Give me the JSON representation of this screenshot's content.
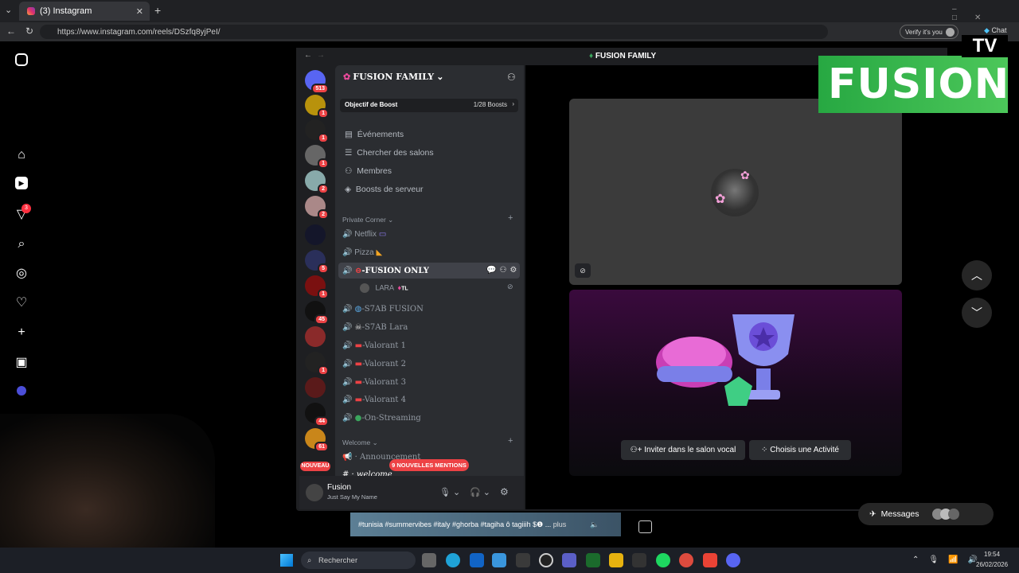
{
  "browser": {
    "tab_title": "(3) Instagram",
    "url": "https://www.instagram.com/reels/DSzfq8yjPeI/",
    "verify_label": "Verify it's you",
    "chat_label": "Chat"
  },
  "instagram": {
    "notif_count": "3",
    "caption": "#tunisia #summervibes #italy #ghorba #tagiha ô tagiiih $❶ ...",
    "caption_more": "plus",
    "messages_label": "Messages"
  },
  "discord": {
    "window_title": "FUSION FAMILY",
    "server_name": "FUSION FAMILY",
    "boost_label": "Objectif de Boost",
    "boost_count": "1/28 Boosts",
    "menu": [
      "Événements",
      "Chercher des salons",
      "Membres",
      "Boosts de serveur"
    ],
    "category_private": "Private Corner",
    "category_welcome": "Welcome",
    "channels": [
      "Netflix",
      "Pizza",
      "-FUSION ONLY",
      "-S7AB FUSION",
      "-S7AB Lara",
      "-Valorant 1",
      "-Valorant 2",
      "-Valorant 3",
      "-Valorant 4",
      "-On-Streaming"
    ],
    "voice_user": "LARA",
    "voice_user_tag": "TL",
    "welcome_channels": [
      "Announcement",
      "welcome"
    ],
    "mentions_pill": "9 NOUVELLES MENTIONS",
    "server_badges": [
      "513",
      "1",
      "1",
      "1",
      "2",
      "2",
      "5",
      "1",
      "45",
      "1",
      "44",
      "61"
    ],
    "new_label": "NOUVEAU",
    "user_name": "Fusion",
    "user_status": "Just Say My Name",
    "invite_button": "Inviter dans le salon vocal",
    "activity_button": "Choisis une Activité"
  },
  "overlay": {
    "brand": "FUSION",
    "tv": "TV"
  },
  "taskbar": {
    "search_placeholder": "Rechercher",
    "time": "19:54",
    "date": "26/02/2026"
  }
}
